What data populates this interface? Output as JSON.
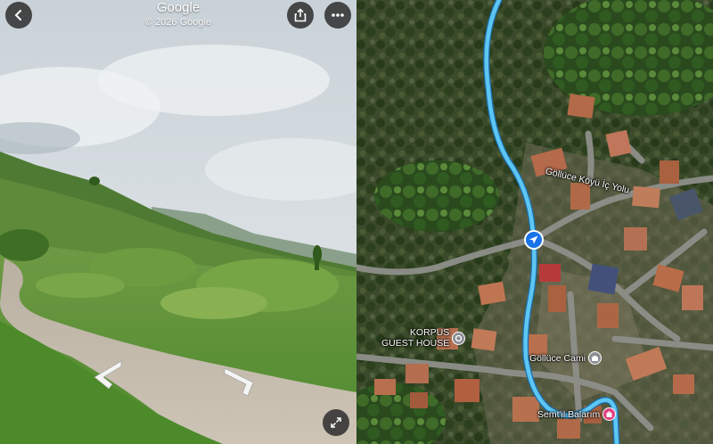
{
  "street_view": {
    "brand": "Google",
    "copyright": "© 2026 Google",
    "icons": {
      "back": "chevron-left-icon",
      "share": "share-icon",
      "more": "more-horizontal-icon",
      "expand": "expand-icon",
      "nav_left": "nav-arrow-left-icon",
      "nav_right": "nav-arrow-right-icon"
    }
  },
  "map": {
    "road_label": "Göllüce Köyü İç Yolu",
    "pois": [
      {
        "name_line1": "KORPUS",
        "name_line2": "GUEST HOUSE",
        "icon": "lodging-pin-icon",
        "color": "#8a8f95"
      },
      {
        "name": "Göllüce Cami",
        "icon": "mosque-pin-icon",
        "color": "#8a8f95"
      },
      {
        "name": "Semt'il Balarım",
        "icon": "shopping-pin-icon",
        "color": "#e0407f"
      }
    ],
    "route_color": "#5ec6f2",
    "location_marker": "navigation-arrow-icon",
    "location_color": "#1a73e8"
  }
}
